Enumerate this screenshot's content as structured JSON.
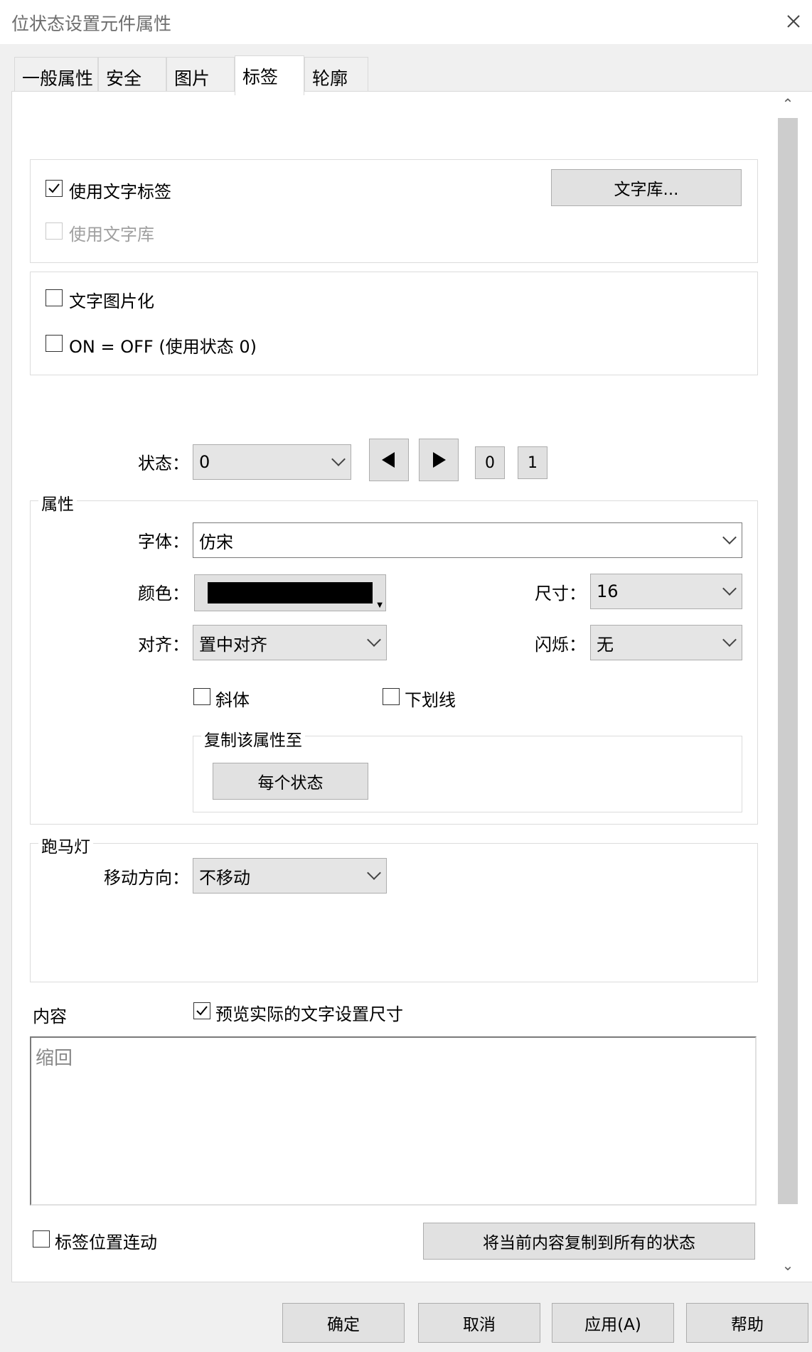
{
  "window": {
    "title": "位状态设置元件属性"
  },
  "tabs": [
    {
      "label": "一般属性"
    },
    {
      "label": "安全"
    },
    {
      "label": "图片"
    },
    {
      "label": "标签"
    },
    {
      "label": "轮廓"
    }
  ],
  "text_label": {
    "use_text_label": "使用文字标签",
    "use_text_library": "使用文字库",
    "library_button": "文字库..."
  },
  "options": {
    "text_to_image": "文字图片化",
    "on_equals_off": "ON = OFF (使用状态 0)"
  },
  "state": {
    "label": "状态：",
    "value": "0",
    "state0": "0",
    "state1": "1"
  },
  "properties": {
    "legend": "属性",
    "font_label": "字体：",
    "font_value": "仿宋",
    "color_label": "颜色：",
    "color_value": "#000000",
    "size_label": "尺寸：",
    "size_value": "16",
    "align_label": "对齐：",
    "align_value": "置中对齐",
    "blink_label": "闪烁：",
    "blink_value": "无",
    "italic": "斜体",
    "underline": "下划线",
    "copy_legend": "复制该属性至",
    "copy_button": "每个状态"
  },
  "marquee": {
    "legend": "跑马灯",
    "direction_label": "移动方向：",
    "direction_value": "不移动"
  },
  "content": {
    "label": "内容",
    "preview_label": "预览实际的文字设置尺寸",
    "text": "缩回"
  },
  "bottom": {
    "link_position": "标签位置连动",
    "copy_all_button": "将当前内容复制到所有的状态"
  },
  "buttons": {
    "ok": "确定",
    "cancel": "取消",
    "apply": "应用(A)",
    "help": "帮助"
  }
}
